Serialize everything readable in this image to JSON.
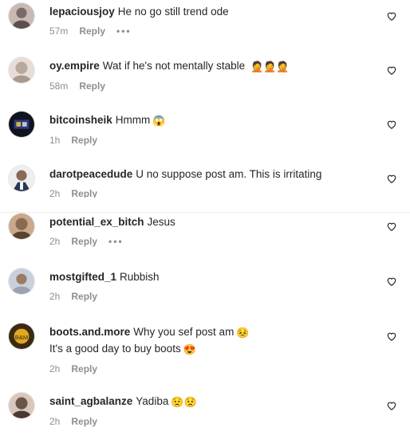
{
  "comments": [
    {
      "user": "lepaciousjoy",
      "text": "He no go still trend ode",
      "emoji": "",
      "text2": "",
      "emoji2": "",
      "time": "57m",
      "reply": "Reply",
      "more": "•••",
      "avatar_color": "#7a6a6a"
    },
    {
      "user": "oy.empire",
      "text": "Wat if he's not mentally stable",
      "emoji": "🤦🤦🤦",
      "text2": "",
      "emoji2": "",
      "time": "58m",
      "reply": "Reply",
      "more": "",
      "avatar_color": "#b9a89c"
    },
    {
      "user": "bitcoinsheik",
      "text": "Hmmm",
      "emoji": "😱",
      "text2": "",
      "emoji2": "",
      "time": "1h",
      "reply": "Reply",
      "more": "",
      "avatar_color": "#111420"
    },
    {
      "user": "darotpeacedude",
      "text": "U no suppose post am. This is irritating",
      "emoji": "",
      "text2": "",
      "emoji2": "",
      "time": "2h",
      "reply": "Reply",
      "more": "",
      "avatar_color": "#d9d6d2"
    },
    {
      "user": "potential_ex_bitch",
      "text": "Jesus",
      "emoji": "",
      "text2": "",
      "emoji2": "",
      "time": "2h",
      "reply": "Reply",
      "more": "•••",
      "avatar_color": "#8a6b50"
    },
    {
      "user": "mostgifted_1",
      "text": "Rubbish",
      "emoji": "",
      "text2": "",
      "emoji2": "",
      "time": "2h",
      "reply": "Reply",
      "more": "",
      "avatar_color": "#9aa2b3"
    },
    {
      "user": "boots.and.more",
      "text": "Why you sef post am",
      "emoji": "😣",
      "text2": "It's a good day to buy boots",
      "emoji2": "😍",
      "time": "2h",
      "reply": "Reply",
      "more": "",
      "avatar_color": "#3b2a12"
    },
    {
      "user": "saint_agbalanze",
      "text": "Yadiba",
      "emoji": "😟😟",
      "text2": "",
      "emoji2": "",
      "time": "2h",
      "reply": "Reply",
      "more": "",
      "avatar_color": "#6b5548"
    }
  ],
  "icons": {
    "like": "heart-outline-icon",
    "more": "more-horizontal-icon"
  }
}
